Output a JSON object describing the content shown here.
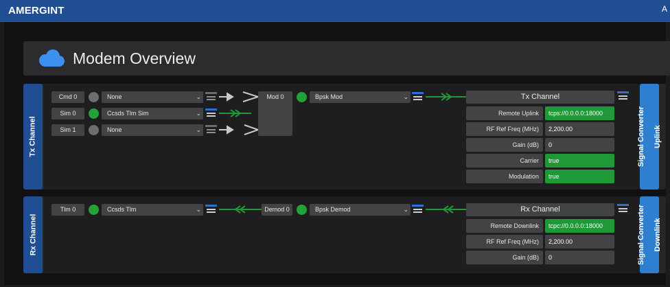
{
  "header": {
    "brand": "AMERGINT",
    "right_glyph": "A"
  },
  "page": {
    "title": "Modem Overview"
  },
  "tx": {
    "left_label": "Tx Channel",
    "right_label_line1": "Signal Converter",
    "right_label_line2": "Uplink",
    "inputs": [
      {
        "name": "Cmd 0",
        "status": "inactive",
        "select": "None"
      },
      {
        "name": "Sim 0",
        "status": "active",
        "select": "Ccsds Tlm Sim"
      },
      {
        "name": "Sim 1",
        "status": "inactive",
        "select": "None"
      }
    ],
    "mod": {
      "name": "Mod 0",
      "status": "active",
      "select": "Bpsk Mod"
    },
    "channel": {
      "title": "Tx Channel",
      "props": [
        {
          "key": "Remote Uplink",
          "value": "tcps://0.0.0.0:18000",
          "highlight": true
        },
        {
          "key": "RF Ref Freq (MHz)",
          "value": "2,200.00",
          "highlight": false
        },
        {
          "key": "Gain (dB)",
          "value": "0",
          "highlight": false
        },
        {
          "key": "Carrier",
          "value": "true",
          "highlight": true
        },
        {
          "key": "Modulation",
          "value": "true",
          "highlight": true
        }
      ]
    }
  },
  "rx": {
    "left_label": "Rx Channel",
    "right_label_line1": "Signal Converter",
    "right_label_line2": "Downlink",
    "output": {
      "name": "Tlm 0",
      "status": "active",
      "select": "Ccsds Tlm"
    },
    "demod": {
      "name": "Demod 0",
      "status": "active",
      "select": "Bpsk Demod"
    },
    "channel": {
      "title": "Rx Channel",
      "props": [
        {
          "key": "Remote Downlink",
          "value": "tcpc://0.0.0.0:18000",
          "highlight": true
        },
        {
          "key": "RF Ref Freq (MHz)",
          "value": "2,200.00",
          "highlight": false
        },
        {
          "key": "Gain (dB)",
          "value": "0",
          "highlight": false
        }
      ]
    }
  },
  "colors": {
    "header_blue": "#1f4e93",
    "tab_blue": "#2e7fcf",
    "active_green": "#21a33a",
    "inactive_grey": "#6d6d70"
  }
}
